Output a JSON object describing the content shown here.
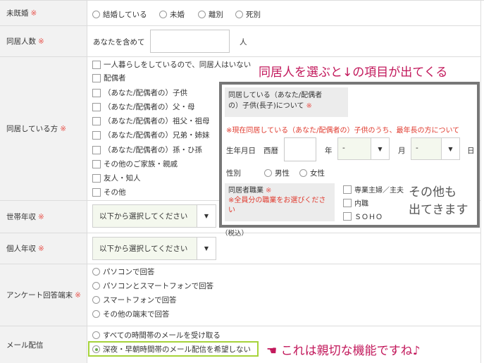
{
  "required_mark": "※",
  "marital": {
    "label": "未既婚",
    "options": [
      "結婚している",
      "未婚",
      "離別",
      "死別"
    ]
  },
  "household_count": {
    "label": "同居人数",
    "prefix": "あなたを含めて",
    "suffix": "人",
    "value": ""
  },
  "cohabitants": {
    "label": "同居している方",
    "options": [
      "一人暮らしをしているので、同居人はいない",
      "配偶者",
      "（あなた/配偶者の）子供",
      "（あなた/配偶者の）父・母",
      "（あなた/配偶者の）祖父・祖母",
      "（あなた/配偶者の）兄弟・姉妹",
      "（あなた/配偶者の）孫・ひ孫",
      "その他のご家族・親戚",
      "友人・知人",
      "その他"
    ]
  },
  "household_income": {
    "label": "世帯年収",
    "select_value": "以下から選択してください",
    "note": "（税込）"
  },
  "personal_income": {
    "label": "個人年収",
    "select_value": "以下から選択してください"
  },
  "survey_device": {
    "label": "アンケート回答端末",
    "options": [
      "パソコンで回答",
      "パソコンとスマートフォンで回答",
      "スマートフォンで回答",
      "その他の端末で回答"
    ]
  },
  "mail_delivery": {
    "label": "メール配信",
    "options": [
      "すべての時間帯のメールを受け取る",
      "深夜・早朝時間帯のメール配信を希望しない"
    ],
    "selected_index": 1
  },
  "overlay": {
    "heading_line1": "同居している（あなた/配偶者",
    "heading_line2": "の）子供(長子)について",
    "red_note": "※現在同居している（あなた/配偶者の）子供のうち、最年長の方について",
    "birthdate_label": "生年月日",
    "era_label": "西暦",
    "year_label": "年",
    "month_label": "月",
    "day_label": "日",
    "year_select": "-",
    "month_select": "-",
    "gender_label": "性別",
    "gender_options": [
      "男性",
      "女性"
    ],
    "job_label": "同居者職業",
    "job_note_line1": "※全員分の職業をお選びくださ",
    "job_note_line2": "い",
    "job_options": [
      "専業主婦／主夫",
      "内職",
      "ＳＯＨＯ"
    ]
  },
  "annotations": {
    "top": "同居人を選ぶと↓の項目が出てくる",
    "other_line1": "その他も",
    "other_line2": "出てきます",
    "bottom_hand": "☚",
    "bottom": "これは親切な機能ですね♪"
  },
  "colors": {
    "required": "#e8554e",
    "annotation": "#c2185b",
    "highlight": "#a6d33a",
    "overlay_border": "#777777"
  }
}
